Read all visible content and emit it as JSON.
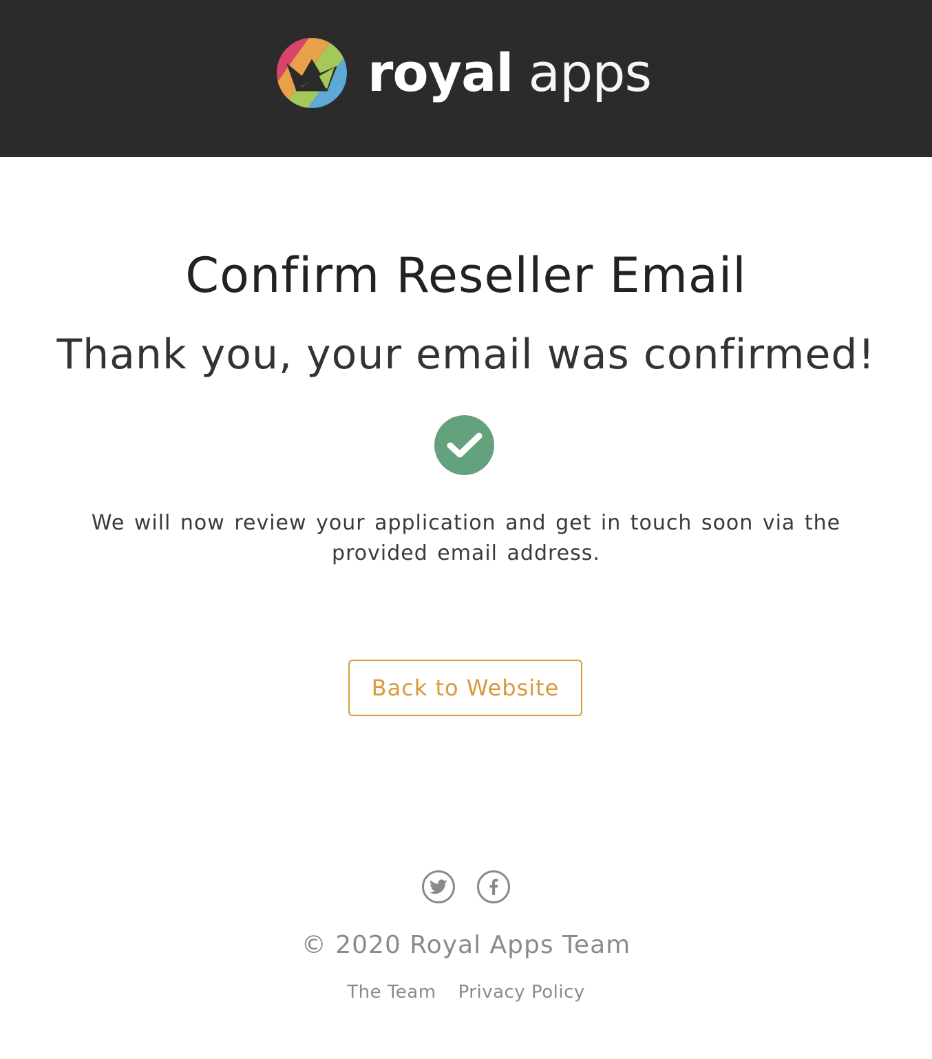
{
  "header": {
    "brand_bold": "royal",
    "brand_light": "apps"
  },
  "main": {
    "title": "Confirm Reseller Email",
    "subtitle": "Thank you, your email was confirmed!",
    "status_icon": "check-circle-icon",
    "message": "We will now review your application and get in touch soon via the provided email address.",
    "back_button_label": "Back to Website"
  },
  "footer": {
    "social": [
      {
        "icon": "twitter-icon"
      },
      {
        "icon": "facebook-icon"
      }
    ],
    "copyright": "© 2020 Royal Apps Team",
    "links": [
      "The Team",
      "Privacy Policy"
    ]
  },
  "colors": {
    "header_bg": "#2b2b2b",
    "accent": "#d9993d",
    "success": "#64a27d",
    "muted": "#8a8a8a"
  }
}
